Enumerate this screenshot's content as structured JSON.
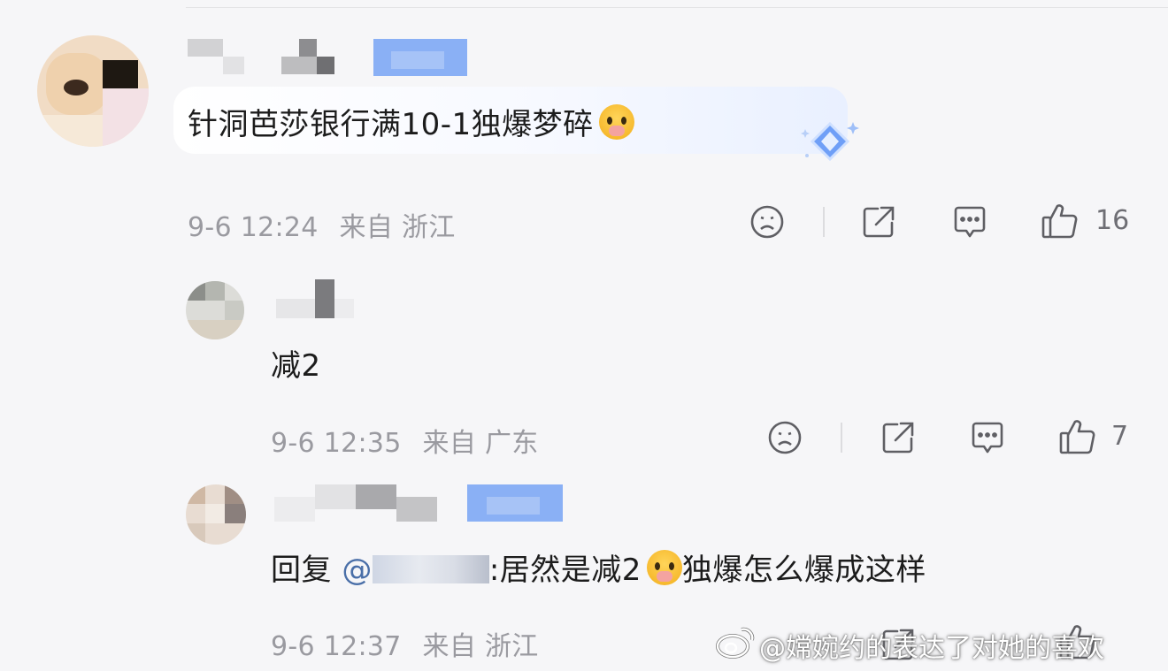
{
  "comments": [
    {
      "text": "针洞芭莎银行满10-1独爆梦碎",
      "time": "9-6 12:24",
      "from": "来自",
      "location": "浙江",
      "likes": "16"
    },
    {
      "text": "减2",
      "time": "9-6 12:35",
      "from": "来自",
      "location": "广东",
      "likes": "7"
    },
    {
      "reply_prefix": "回复",
      "mention": "@",
      "text_before_emoji": ":居然是减2",
      "text_after_emoji": "独爆怎么爆成这样",
      "time": "9-6 12:37",
      "from": "来自",
      "location": "浙江"
    }
  ],
  "watermark": "@嫦婉约的表达了对她的喜欢",
  "colors": {
    "background": "#f6f6f8",
    "meta_text": "#9a9aa0",
    "mention": "#4a6fa8",
    "vip_badge": "#8ab0f5"
  },
  "icons": [
    "dislike-face-icon",
    "share-icon",
    "comment-icon",
    "like-thumb-icon",
    "diamond-badge-icon",
    "crying-emoji-icon",
    "weibo-logo-icon"
  ]
}
